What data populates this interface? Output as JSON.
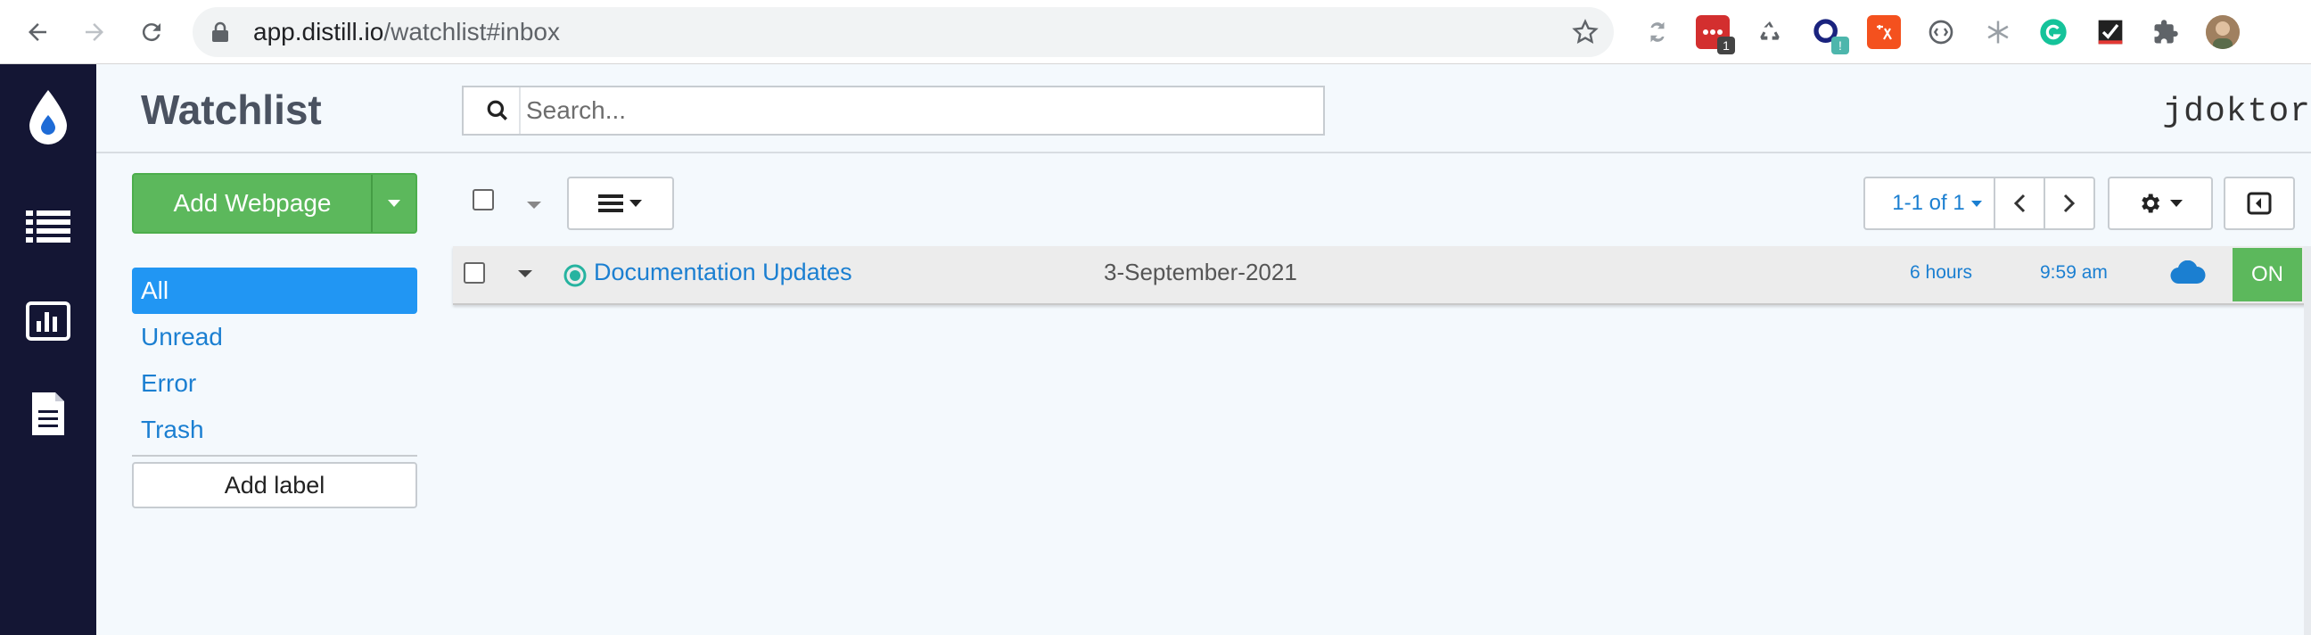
{
  "browser": {
    "url_host": "app.distill.io",
    "url_path": "/watchlist#inbox",
    "extensions": [
      {
        "name": "extension-1-icon",
        "badge": ""
      },
      {
        "name": "extension-2-icon",
        "badge": "1"
      },
      {
        "name": "recycle-extension-icon",
        "badge": ""
      },
      {
        "name": "extension-4-icon",
        "badge": "!"
      },
      {
        "name": "extension-5-icon",
        "badge": ""
      },
      {
        "name": "extension-6-icon",
        "badge": ""
      },
      {
        "name": "snowflake-extension-icon",
        "badge": ""
      },
      {
        "name": "grammarly-extension-icon",
        "badge": ""
      },
      {
        "name": "checkbox-extension-icon",
        "badge": ""
      },
      {
        "name": "puzzle-icon",
        "badge": ""
      },
      {
        "name": "profile-avatar",
        "badge": ""
      }
    ]
  },
  "rail": {
    "items": [
      "droplet-logo-icon",
      "list-icon",
      "bar-chart-icon",
      "document-icon"
    ]
  },
  "header": {
    "title": "Watchlist",
    "search_placeholder": "Search...",
    "username": "jdoktor"
  },
  "sidebar": {
    "add_button": "Add Webpage",
    "items": [
      {
        "label": "All",
        "active": true
      },
      {
        "label": "Unread",
        "active": false
      },
      {
        "label": "Error",
        "active": false
      },
      {
        "label": "Trash",
        "active": false
      }
    ],
    "add_label": "Add label"
  },
  "toolbar": {
    "pager_text": "1-1 of 1"
  },
  "rows": [
    {
      "title": "Documentation Updates",
      "date": "3-September-2021",
      "frequency": "6 hours",
      "time": "9:59 am",
      "state": "ON"
    }
  ],
  "colors": {
    "rail": "#141634",
    "primary": "#1b7fd1",
    "active": "#2196f3",
    "success": "#5cb85c",
    "status_dot": "#26b3a0"
  }
}
